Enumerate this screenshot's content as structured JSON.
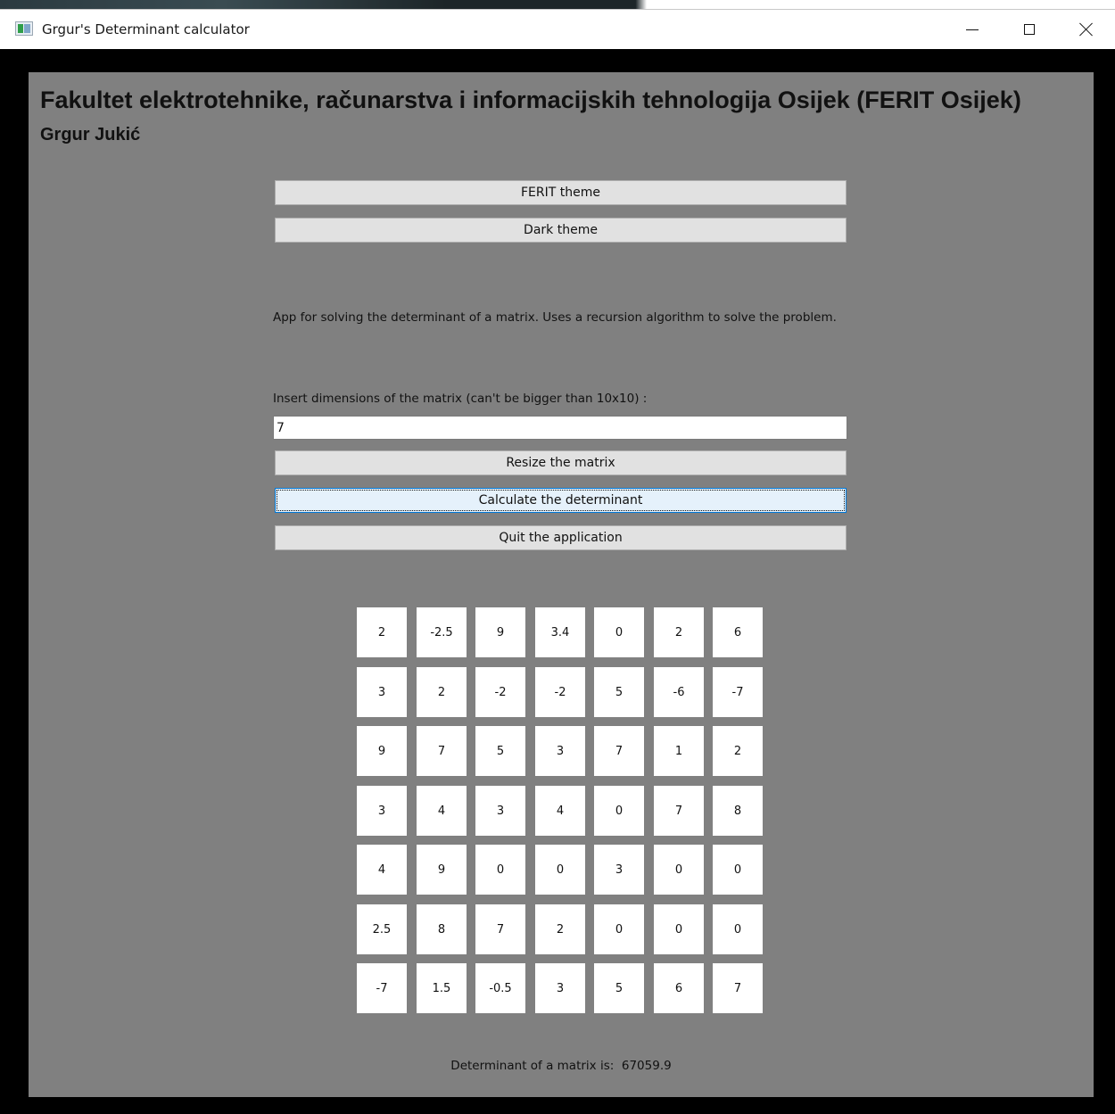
{
  "window": {
    "title": "Grgur's Determinant calculator",
    "icons": [
      "app-icon",
      "minimize-icon",
      "maximize-icon",
      "close-icon"
    ]
  },
  "header": {
    "title": "Fakultet elektrotehnike, računarstva i informacijskih tehnologija Osijek (FERIT Osijek)",
    "author": "Grgur Jukić"
  },
  "theme_buttons": {
    "ferit": "FERIT theme",
    "dark": "Dark theme"
  },
  "description": "App for solving the determinant of a matrix. Uses a recursion algorithm to solve the problem.",
  "dimensions": {
    "label": "Insert dimensions of the matrix (can't be bigger than 10x10) :",
    "value": "7"
  },
  "actions": {
    "resize": "Resize the matrix",
    "calculate": "Calculate the determinant",
    "quit": "Quit the application"
  },
  "matrix": [
    [
      "2",
      "-2.5",
      "9",
      "3.4",
      "0",
      "2",
      "6"
    ],
    [
      "3",
      "2",
      "-2",
      "-2",
      "5",
      "-6",
      "-7"
    ],
    [
      "9",
      "7",
      "5",
      "3",
      "7",
      "1",
      "2"
    ],
    [
      "3",
      "4",
      "3",
      "4",
      "0",
      "7",
      "8"
    ],
    [
      "4",
      "9",
      "0",
      "0",
      "3",
      "0",
      "0"
    ],
    [
      "2.5",
      "8",
      "7",
      "2",
      "0",
      "0",
      "0"
    ],
    [
      "-7",
      "1.5",
      "-0.5",
      "3",
      "5",
      "6",
      "7"
    ]
  ],
  "result": {
    "label": "Determinant of a matrix is:",
    "value": "67059.9"
  },
  "colors": {
    "client_background": "#808080",
    "frame": "#000000",
    "button": "#e1e1e1",
    "focused_button": "#e5f1fb",
    "cell": "#ffffff"
  }
}
